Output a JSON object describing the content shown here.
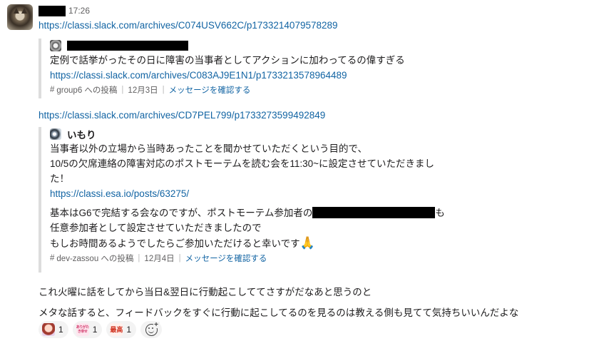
{
  "message": {
    "time": "17:26",
    "link1": "https://classi.slack.com/archives/C074USV662C/p1733214079578289",
    "quote1": {
      "text": "定例で話挙がったその日に障害の当事者としてアクションに加わってるの偉すぎる",
      "link": "https://classi.slack.com/archives/C083AJ9E1N1/p1733213578964489",
      "channel": "group6 への投稿",
      "date": "12月3日",
      "confirm": "メッセージを確認する"
    },
    "link2": "https://classi.slack.com/archives/CD7PEL799/p1733273599492849",
    "quote2": {
      "author": "いもり",
      "lines": [
        "当事者以外の立場から当時あったことを聞かせていただくという目的で、",
        "10/5の欠席連絡の障害対応のポストモーテムを読む会を11:30~に設定させていただきまし",
        "た！"
      ],
      "link": "https://classi.esa.io/posts/63275/",
      "line4_pre": "基本はG6で完結する会なのですが、ポストモーテム参加者の",
      "line4_post": "も",
      "line5": "任意参加者として設定させていただきましたので",
      "line6": "もしお時間あるようでしたらご参加いただけると幸いです",
      "pray_emoji": "🙏",
      "channel": "dev-zassou への投稿",
      "date": "12月4日",
      "confirm": "メッセージを確認する"
    },
    "para1": "これ火曜に話をしてから当日&翌日に行動起こしててさすがだなあと思うのと",
    "para2": "メタな話すると、フィードバックをすぐに行動に起こしてるのを見るのは教える側も見てて気持ちいいんだよな"
  },
  "reactions": [
    {
      "emoji": "person-emoji",
      "count": "1"
    },
    {
      "emoji": "arigato-emoji",
      "label": "ありがたき幸せ",
      "count": "1"
    },
    {
      "emoji": "saiko-emoji",
      "label": "最高",
      "count": "1"
    }
  ],
  "colors": {
    "link": "#1264a3",
    "meta": "#616061",
    "quote_bar": "#dddddd"
  }
}
